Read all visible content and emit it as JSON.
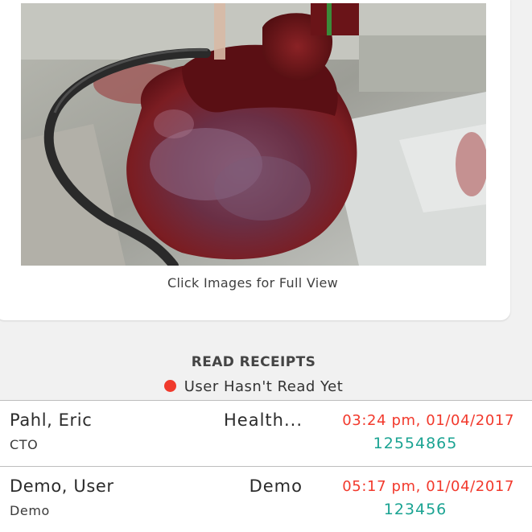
{
  "image_card": {
    "image_alt": "heart",
    "caption": "Click Images for Full View"
  },
  "read_receipts": {
    "title": "READ RECEIPTS",
    "legend_label": "User Hasn't Read Yet",
    "legend_color": "#f03a2c",
    "rows": [
      {
        "name": "Pahl, Eric",
        "title": "CTO",
        "department": "Health...",
        "timestamp": "03:24 pm, 01/04/2017",
        "id": "12554865"
      },
      {
        "name": "Demo, User",
        "title": "Demo",
        "department": "Demo",
        "timestamp": "05:17 pm, 01/04/2017",
        "id": "123456"
      }
    ]
  },
  "colors": {
    "timestamp": "#f2392c",
    "id": "#1aa392",
    "background": "#f1f1f1"
  }
}
